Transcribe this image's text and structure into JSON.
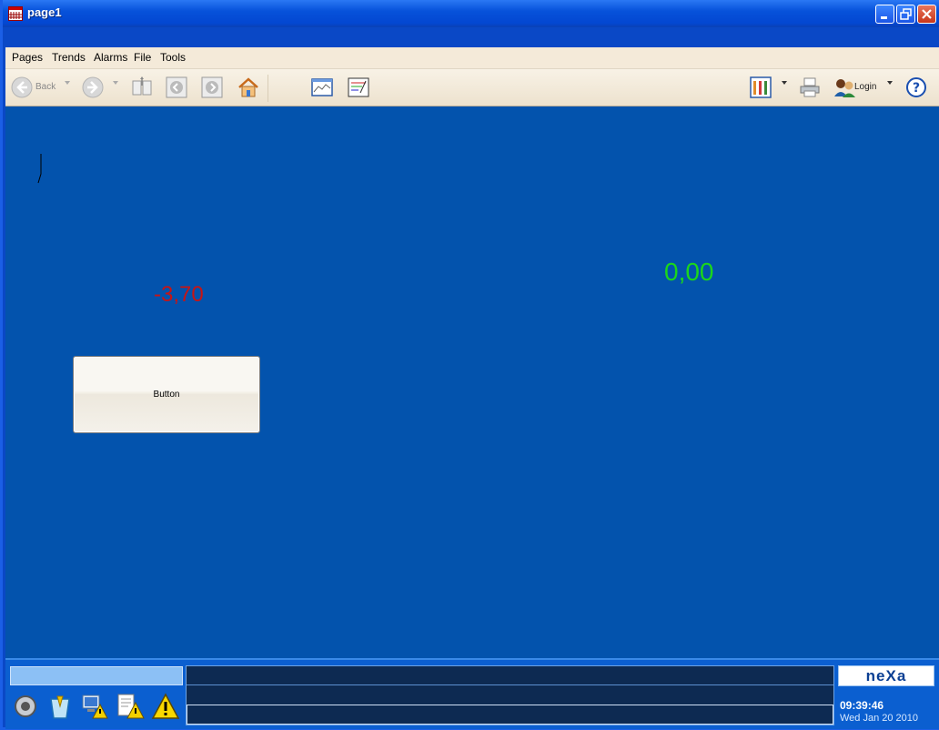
{
  "window": {
    "title": "page1"
  },
  "menu": {
    "items": [
      "Pages",
      "Trends",
      "Alarms",
      "File",
      "Tools"
    ]
  },
  "toolbar": {
    "back_label": "Back",
    "login_label": "Login"
  },
  "canvas": {
    "value_red": "-3,70",
    "value_green": "0,00",
    "button_label": "Button"
  },
  "status": {
    "logo_text": "neXa",
    "time": "09:39:46",
    "date": "Wed Jan 20 2010"
  },
  "colors": {
    "canvas_bg": "#0353ad",
    "value_red": "#c81414",
    "value_green": "#1bd61b"
  }
}
